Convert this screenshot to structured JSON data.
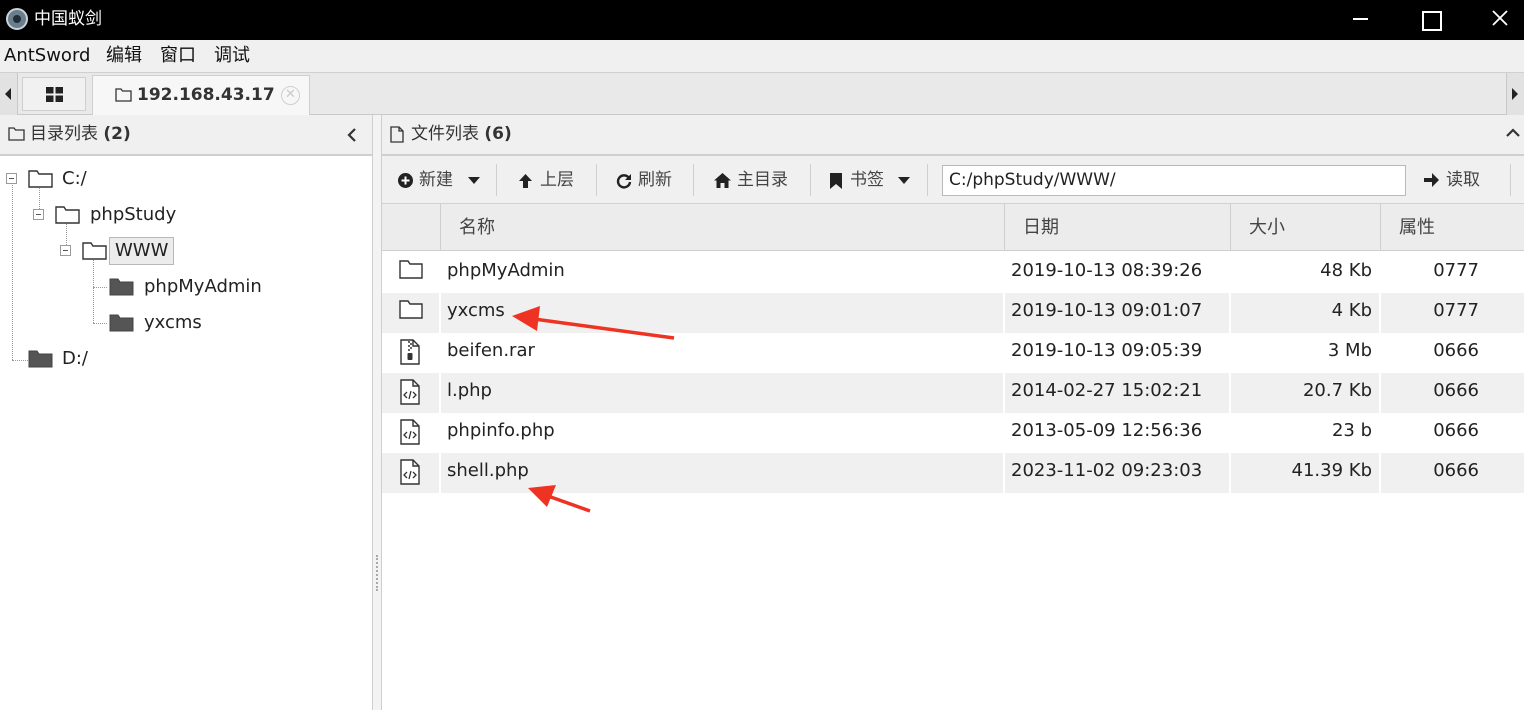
{
  "window": {
    "title": "中国蚁剑"
  },
  "menu": {
    "items": [
      "AntSword",
      "编辑",
      "窗口",
      "调试"
    ]
  },
  "tabs": {
    "host_label": "192.168.43.17"
  },
  "dir_panel": {
    "title": "目录列表",
    "count": "(2)",
    "tree": {
      "c_drive": "C:/",
      "phpstudy": "phpStudy",
      "www": "WWW",
      "phpmyadmin": "phpMyAdmin",
      "yxcms": "yxcms",
      "d_drive": "D:/"
    }
  },
  "file_panel": {
    "title": "文件列表",
    "count": "(6)",
    "toolbar": {
      "new_label": "新建",
      "up_label": "上层",
      "refresh_label": "刷新",
      "home_label": "主目录",
      "bookmark_label": "书签",
      "path_value": "C:/phpStudy/WWW/",
      "read_label": "读取"
    },
    "columns": {
      "name": "名称",
      "date": "日期",
      "size": "大小",
      "attr": "属性"
    },
    "rows": [
      {
        "icon": "folder-icon",
        "name": "phpMyAdmin",
        "date": "2019-10-13 08:39:26",
        "size": "48 Kb",
        "attr": "0777"
      },
      {
        "icon": "folder-icon",
        "name": "yxcms",
        "date": "2019-10-13 09:01:07",
        "size": "4 Kb",
        "attr": "0777"
      },
      {
        "icon": "archive-file-icon",
        "name": "beifen.rar",
        "date": "2019-10-13 09:05:39",
        "size": "3 Mb",
        "attr": "0666"
      },
      {
        "icon": "code-file-icon",
        "name": "l.php",
        "date": "2014-02-27 15:02:21",
        "size": "20.7 Kb",
        "attr": "0666"
      },
      {
        "icon": "code-file-icon",
        "name": "phpinfo.php",
        "date": "2013-05-09 12:56:36",
        "size": "23 b",
        "attr": "0666"
      },
      {
        "icon": "code-file-icon",
        "name": "shell.php",
        "date": "2023-11-02 09:23:03",
        "size": "41.39 Kb",
        "attr": "0666"
      }
    ]
  },
  "colors": {
    "titlebar": "#000000",
    "annotation_arrow": "#ee3322",
    "row_alt": "#f0f0f0"
  }
}
